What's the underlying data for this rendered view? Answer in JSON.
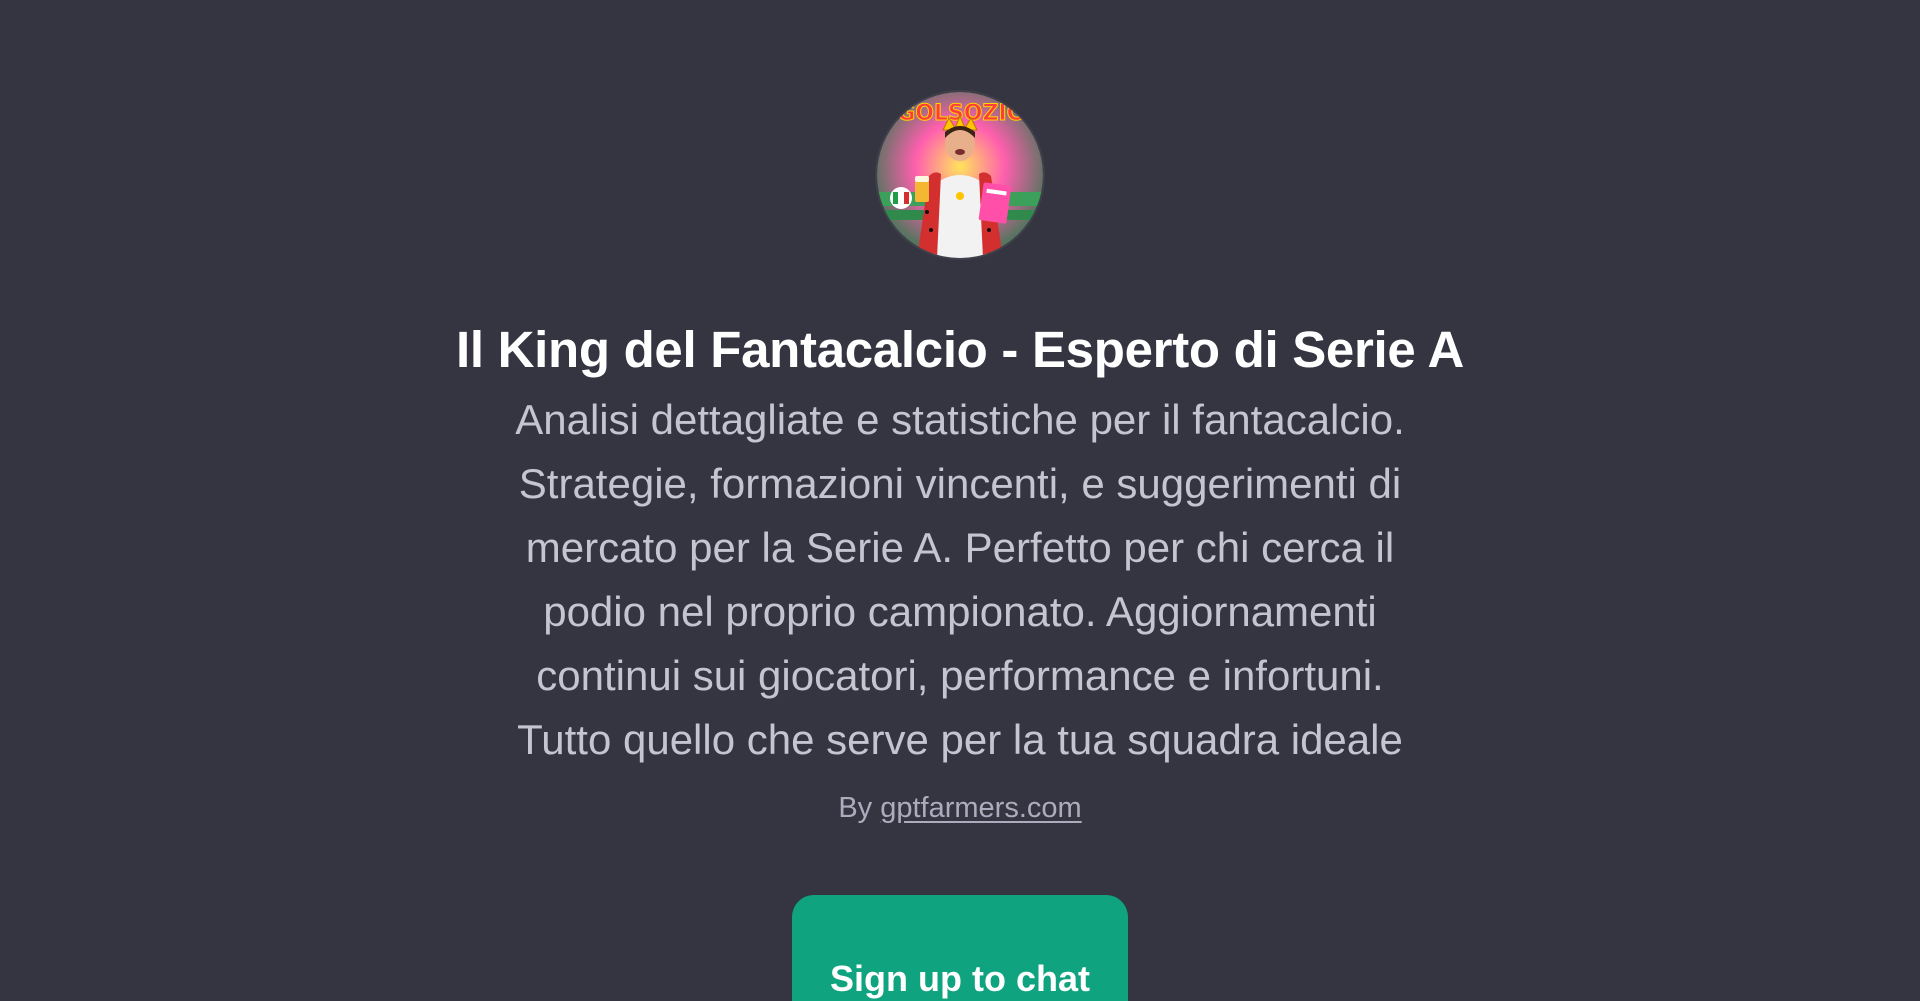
{
  "gpt": {
    "title": "Il King del Fantacalcio - Esperto di Serie A",
    "description_lines": [
      "Analisi dettagliate e statistiche per il fantacalcio.",
      "Strategie, formazioni vincenti, e suggerimenti di",
      "mercato per la Serie A. Perfetto per chi cerca il",
      "podio nel proprio campionato. Aggiornamenti",
      "continui sui giocatori, performance e infortuni.",
      "Tutto quello che serve per la tua squadra ideale"
    ],
    "byline_prefix": "By",
    "author_link": "gptfarmers.com",
    "avatar_icon": "gpt-avatar-king-fantacalcio"
  },
  "cta": {
    "signup_label": "Sign up to chat"
  },
  "colors": {
    "background": "#343541",
    "title": "#ffffff",
    "description": "#c5c5d2",
    "byline": "#acacbe",
    "accent": "#10a37f"
  }
}
